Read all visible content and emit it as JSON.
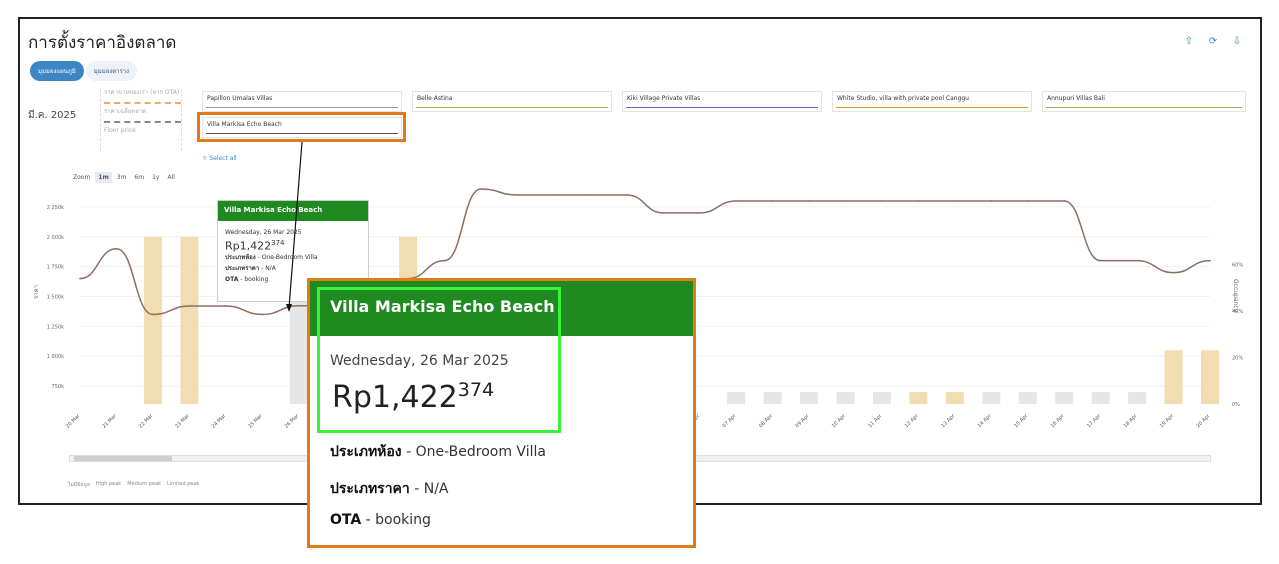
{
  "page": {
    "title": "การตั้งราคาอิงตลาด",
    "month": "มี.ค. 2025"
  },
  "toggle": {
    "graph_view": "มุมมองแผนภูมิ",
    "table_view": "มุมมองตาราง"
  },
  "toolbar_icons": [
    "upload-icon",
    "refresh-icon",
    "download-icon"
  ],
  "legend": {
    "items": [
      {
        "label": "ราคาขายของเรา (จาก OTA)",
        "color": "#f0a868"
      },
      {
        "label": "ราคาเฉลี่ยตลาด",
        "color": "#888888"
      },
      {
        "label": "Floor price",
        "color": "#cccccc"
      }
    ]
  },
  "competitors": [
    {
      "name": "Papillon Umalas Villas",
      "color": "#9b9b9b"
    },
    {
      "name": "Belle Astina",
      "color": "#8bc34a"
    },
    {
      "name": "Kiki Village Private Villas",
      "color": "#7e57c2"
    },
    {
      "name": "White Studio, villa with private pool Canggu",
      "color": "#d4a017"
    },
    {
      "name": "Annupuri Villas Bali",
      "color": "#8bc34a"
    },
    {
      "name": "Villa Markisa Echo Beach",
      "color": "#555555"
    }
  ],
  "select_all": "Select all",
  "zoom": {
    "label": "Zoom",
    "options": [
      "1m",
      "3m",
      "6m",
      "1y",
      "All"
    ],
    "selected": "1m"
  },
  "chart_data": {
    "type": "line",
    "x": [
      "20 Mar",
      "21 Mar",
      "22 Mar",
      "23 Mar",
      "24 Mar",
      "25 Mar",
      "26 Mar",
      "27 Mar",
      "28 Mar",
      "29 Mar",
      "30 Mar",
      "31 Mar",
      "01 Apr",
      "02 Apr",
      "03 Apr",
      "04 Apr",
      "05 Apr",
      "06 Apr",
      "07 Apr",
      "08 Apr",
      "09 Apr",
      "10 Apr",
      "11 Apr",
      "12 Apr",
      "13 Apr",
      "14 Apr",
      "15 Apr",
      "16 Apr",
      "17 Apr",
      "18 Apr",
      "19 Apr",
      "20 Apr"
    ],
    "y_ticks": [
      "750k",
      "1 000k",
      "1 250k",
      "1 500k",
      "1 750k",
      "2 000k",
      "2 250k"
    ],
    "y2_ticks": [
      "0%",
      "20%",
      "40%",
      "60%"
    ],
    "ylabel": "ราคา",
    "y2label": "Occupancy",
    "ylim": [
      600000,
      2400000
    ],
    "series": [
      {
        "name": "Villa Markisa Echo Beach",
        "values": [
          1650000,
          1900000,
          1350000,
          1420000,
          1420000,
          1350000,
          1422374,
          1420000,
          1450000,
          1650000,
          1800000,
          2400000,
          2350000,
          2350000,
          2350000,
          2350000,
          2200000,
          2200000,
          2300000,
          2300000,
          2300000,
          2300000,
          2300000,
          2300000,
          2300000,
          2300000,
          2300000,
          2300000,
          1800000,
          1800000,
          1700000,
          1800000
        ]
      }
    ],
    "bars": {
      "values": [
        2000000,
        0,
        2000000,
        2000000,
        0,
        0,
        1500000,
        0,
        1500000,
        2000000,
        0,
        0,
        0,
        0,
        0,
        0,
        0,
        0,
        700000,
        700000,
        700000,
        700000,
        700000,
        700000,
        700000,
        700000,
        700000,
        700000,
        700000,
        700000,
        1050000,
        1050000
      ],
      "peak": [
        "none",
        "medium",
        "high",
        "high",
        "none",
        "none",
        "medium",
        "none",
        "medium",
        "high",
        "none",
        "none",
        "none",
        "none",
        "none",
        "none",
        "none",
        "none",
        "medium",
        "medium",
        "medium",
        "medium",
        "medium",
        "high",
        "high",
        "medium",
        "medium",
        "medium",
        "medium",
        "medium",
        "high",
        "high"
      ]
    }
  },
  "bottom_legend": {
    "items": [
      "ไม่มีข้อมูล",
      "High peak",
      "Medium peak",
      "Limited peak"
    ],
    "scroll_label": "1M"
  },
  "tooltip": {
    "title": "Villa Markisa Echo Beach",
    "date": "Wednesday, 26 Mar 2025",
    "price_main": "Rp1,422",
    "price_sup": "374",
    "room_type_label": "ประเภทห้อง",
    "room_type_value": "One-Bedroom Villa",
    "rate_type_label": "ประเภทราคา",
    "rate_type_value": "N/A",
    "ota_label": "OTA",
    "ota_value": "booking"
  }
}
